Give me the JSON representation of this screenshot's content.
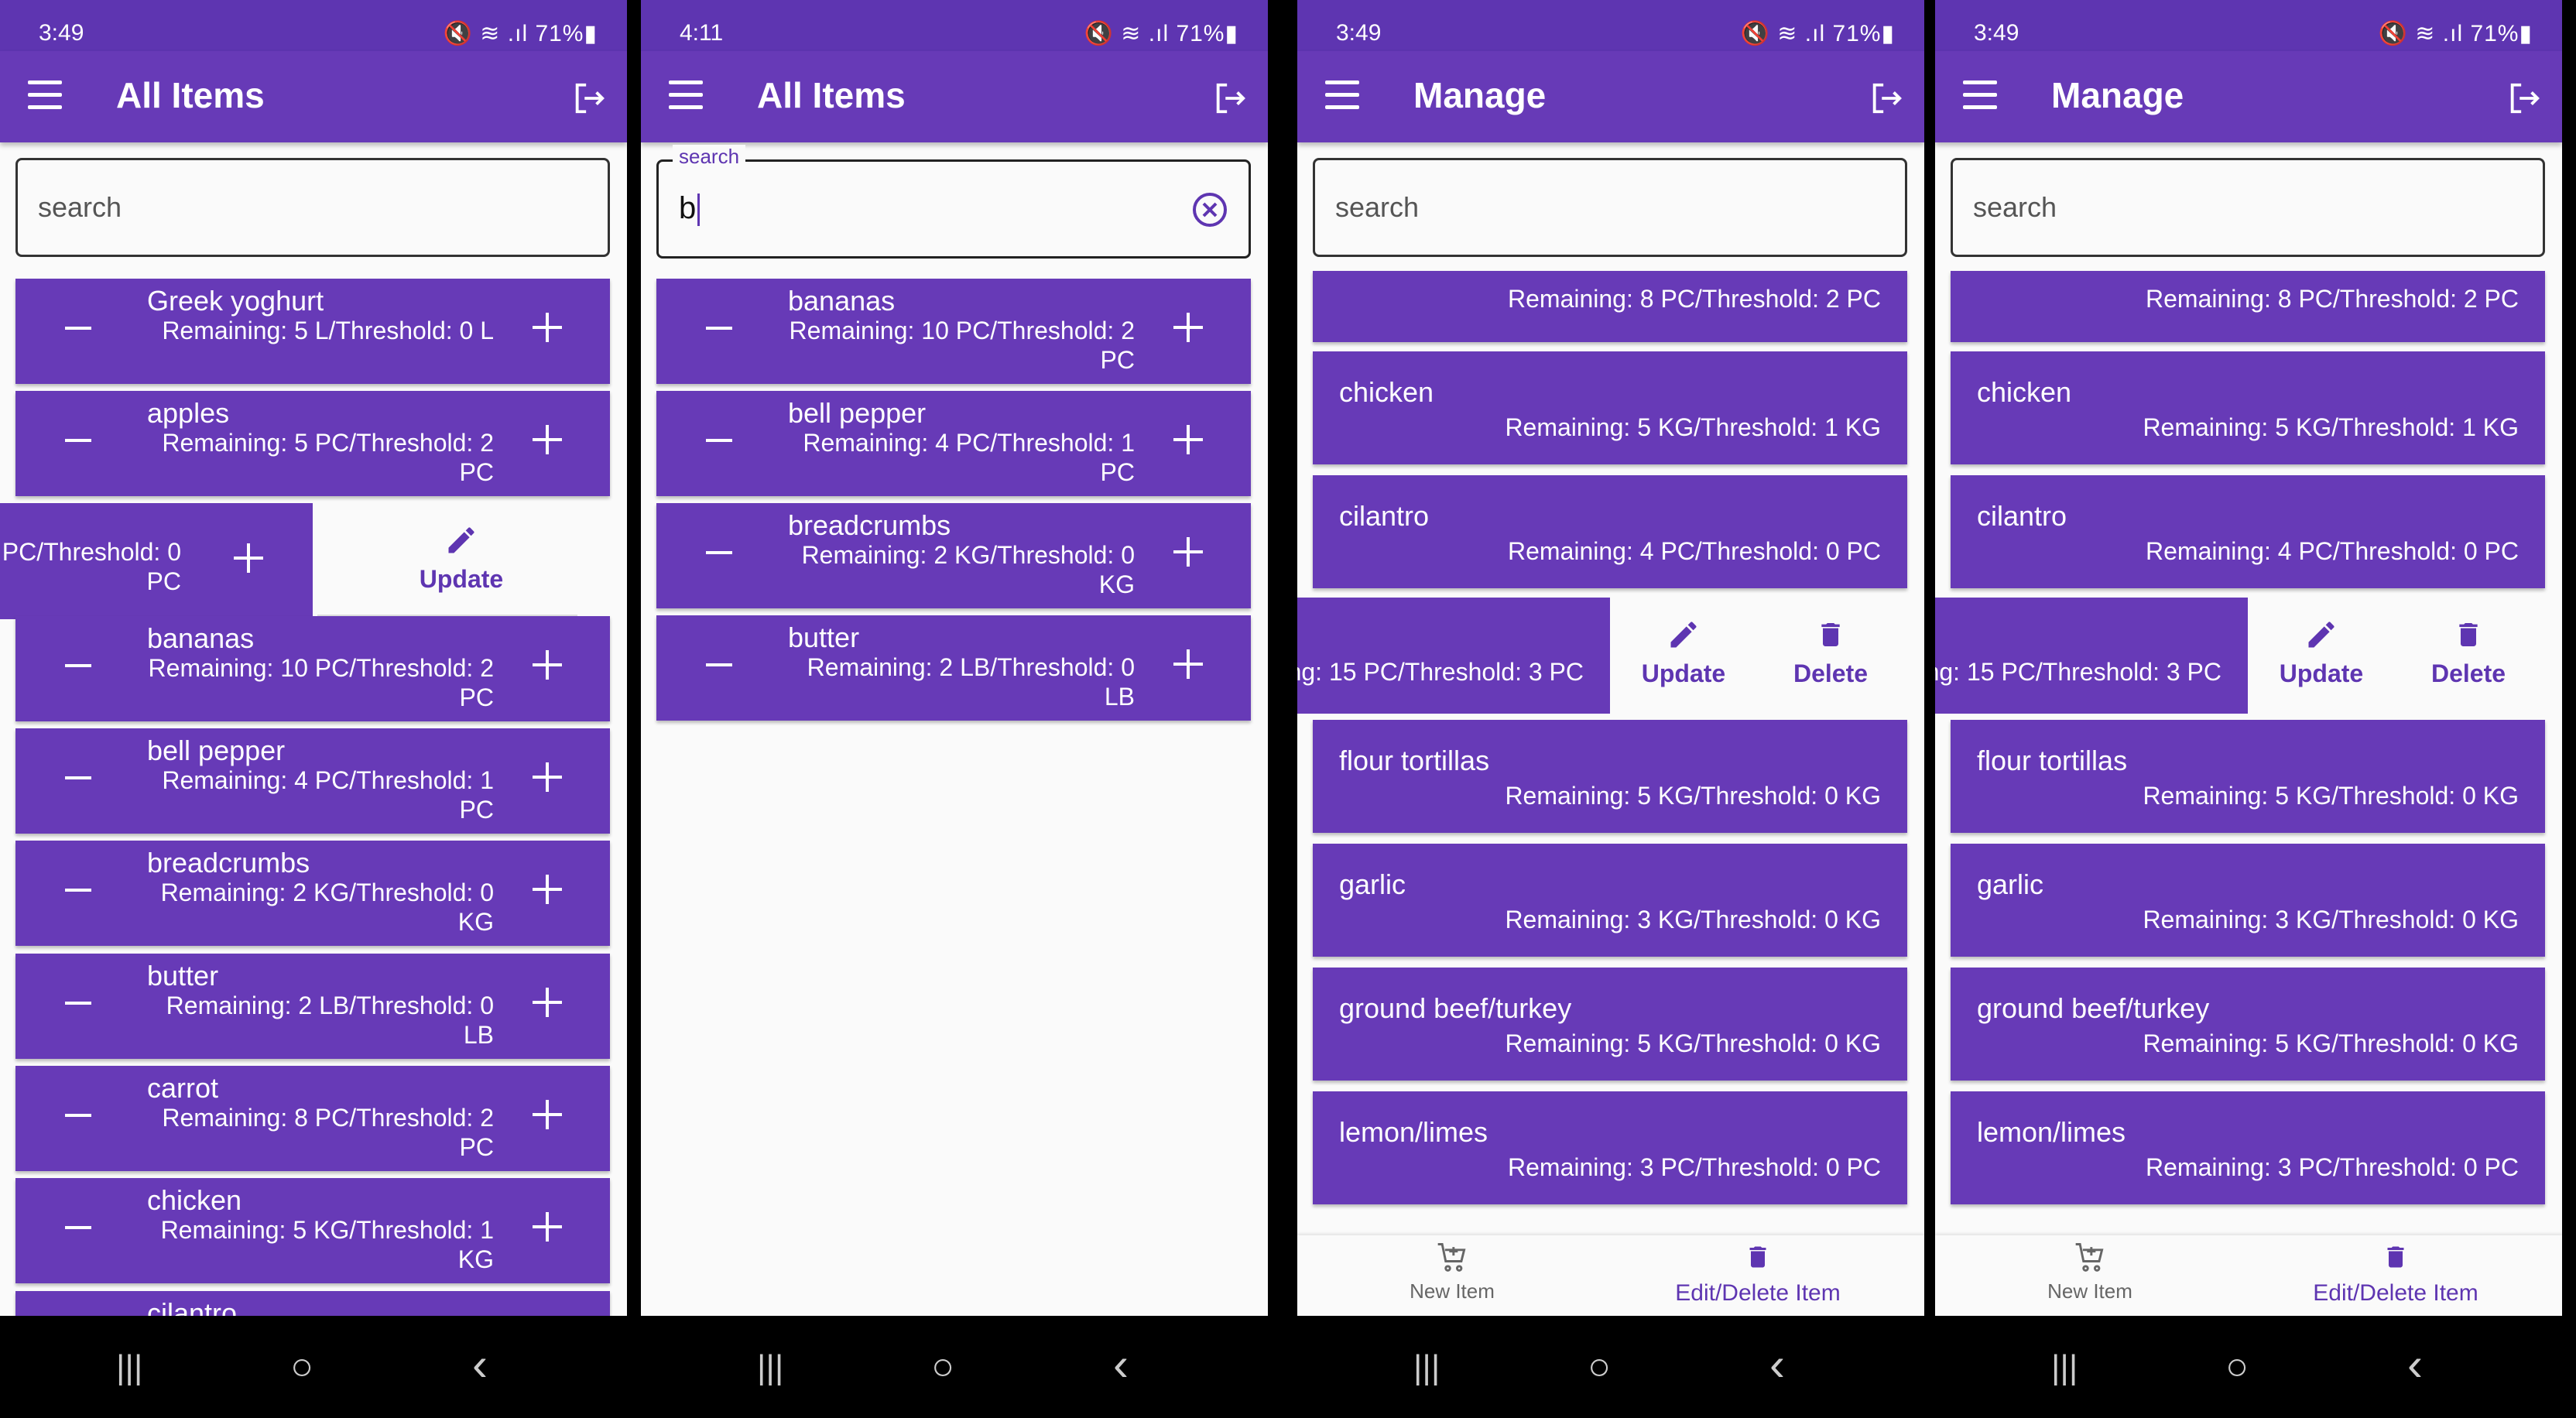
{
  "status_bars": [
    {
      "time": "3:49",
      "right": "🔇 ≋ .ıl 71%▮"
    },
    {
      "time": "4:11",
      "right": "🔇 ≋ .ıl 71%▮"
    },
    {
      "time": "3:49",
      "right": "🔇 ≋ .ıl 71%▮"
    },
    {
      "time": "3:49",
      "right": "🔇 ≋ .ıl 71%▮"
    }
  ],
  "titles": [
    "All Items",
    "All Items",
    "Manage",
    "Manage"
  ],
  "search": {
    "placeholder": "search",
    "label": "search",
    "typed_value": "b"
  },
  "panel1_items": [
    {
      "name": "Greek yoghurt",
      "detail": "Remaining: 5 L/Threshold: 0 L"
    },
    {
      "name": "apples",
      "detail": "Remaining: 5 PC/Threshold: 2 PC"
    },
    {
      "name": "",
      "detail": "PC/Threshold: 0 PC"
    },
    {
      "name": "bananas",
      "detail": "Remaining: 10 PC/Threshold: 2 PC"
    },
    {
      "name": "bell pepper",
      "detail": "Remaining: 4 PC/Threshold: 1 PC"
    },
    {
      "name": "breadcrumbs",
      "detail": "Remaining: 2 KG/Threshold: 0 KG"
    },
    {
      "name": "butter",
      "detail": "Remaining: 2 LB/Threshold: 0 LB"
    },
    {
      "name": "carrot",
      "detail": "Remaining: 8 PC/Threshold: 2 PC"
    },
    {
      "name": "chicken",
      "detail": "Remaining: 5 KG/Threshold: 1 KG"
    },
    {
      "name": "cilantro",
      "detail": ""
    }
  ],
  "panel2_items": [
    {
      "name": "bananas",
      "detail": "Remaining: 10 PC/Threshold: 2 PC"
    },
    {
      "name": "bell pepper",
      "detail": "Remaining: 4 PC/Threshold: 1 PC"
    },
    {
      "name": "breadcrumbs",
      "detail": "Remaining: 2 KG/Threshold: 0 KG"
    },
    {
      "name": "butter",
      "detail": "Remaining: 2 LB/Threshold: 0 LB"
    }
  ],
  "manage_items": [
    {
      "name": "",
      "detail": "Remaining: 8 PC/Threshold: 2 PC"
    },
    {
      "name": "chicken",
      "detail": "Remaining: 5 KG/Threshold: 1 KG"
    },
    {
      "name": "cilantro",
      "detail": "Remaining: 4 PC/Threshold: 0 PC"
    },
    {
      "name": "",
      "detail": "ng: 15 PC/Threshold: 3 PC"
    },
    {
      "name": "flour tortillas",
      "detail": "Remaining: 5 KG/Threshold: 0 KG"
    },
    {
      "name": "garlic",
      "detail": "Remaining: 3 KG/Threshold: 0 KG"
    },
    {
      "name": "ground beef/turkey",
      "detail": "Remaining: 5 KG/Threshold: 0 KG"
    },
    {
      "name": "lemon/limes",
      "detail": "Remaining: 3 PC/Threshold: 0 PC"
    }
  ],
  "actions": {
    "update": "Update",
    "delete": "Delete"
  },
  "bottom_nav": {
    "new_item": "New Item",
    "edit_delete": "Edit/Delete Item"
  },
  "system_nav": {
    "recents": "|||",
    "home": "○",
    "back": "‹"
  },
  "colors": {
    "primary": "#673ab7",
    "status": "#5e35b1",
    "background": "#fafafa"
  }
}
